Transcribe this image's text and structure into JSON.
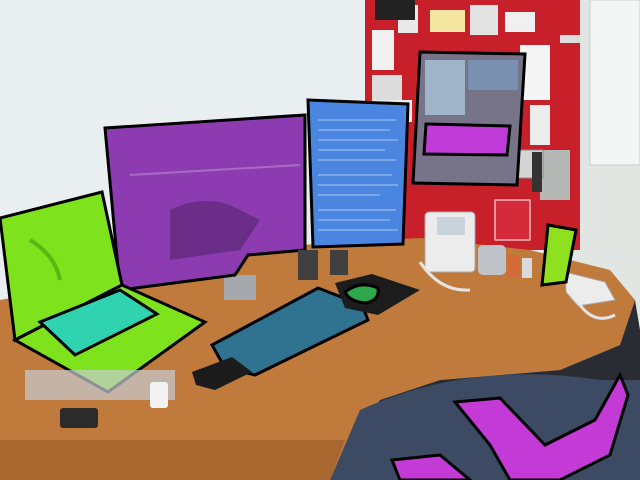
{
  "scene": {
    "description_free": true,
    "overlay_colors": {
      "laptop": "#7ee21c",
      "laptop_screen_area": "#2fd3b0",
      "monitor_large": "#8d3bb0",
      "monitor_portrait": "#4a86e0",
      "monitor_small": "#777388",
      "monitor_small_area": "#c13bd8",
      "keyboard": "#2f7390",
      "mouse": "#2ea84a",
      "chair": "#c43ad6",
      "glass": "#8fe01f",
      "outline": "#000000"
    },
    "objects": [
      {
        "name": "laptop"
      },
      {
        "name": "large-monitor"
      },
      {
        "name": "portrait-monitor"
      },
      {
        "name": "wall-monitor"
      },
      {
        "name": "keyboard"
      },
      {
        "name": "mouse"
      },
      {
        "name": "mouse-pad"
      },
      {
        "name": "desk-phone-left"
      },
      {
        "name": "desk-phone-right"
      },
      {
        "name": "office-chair"
      },
      {
        "name": "green-glass"
      },
      {
        "name": "corkboard"
      },
      {
        "name": "desk"
      }
    ]
  }
}
